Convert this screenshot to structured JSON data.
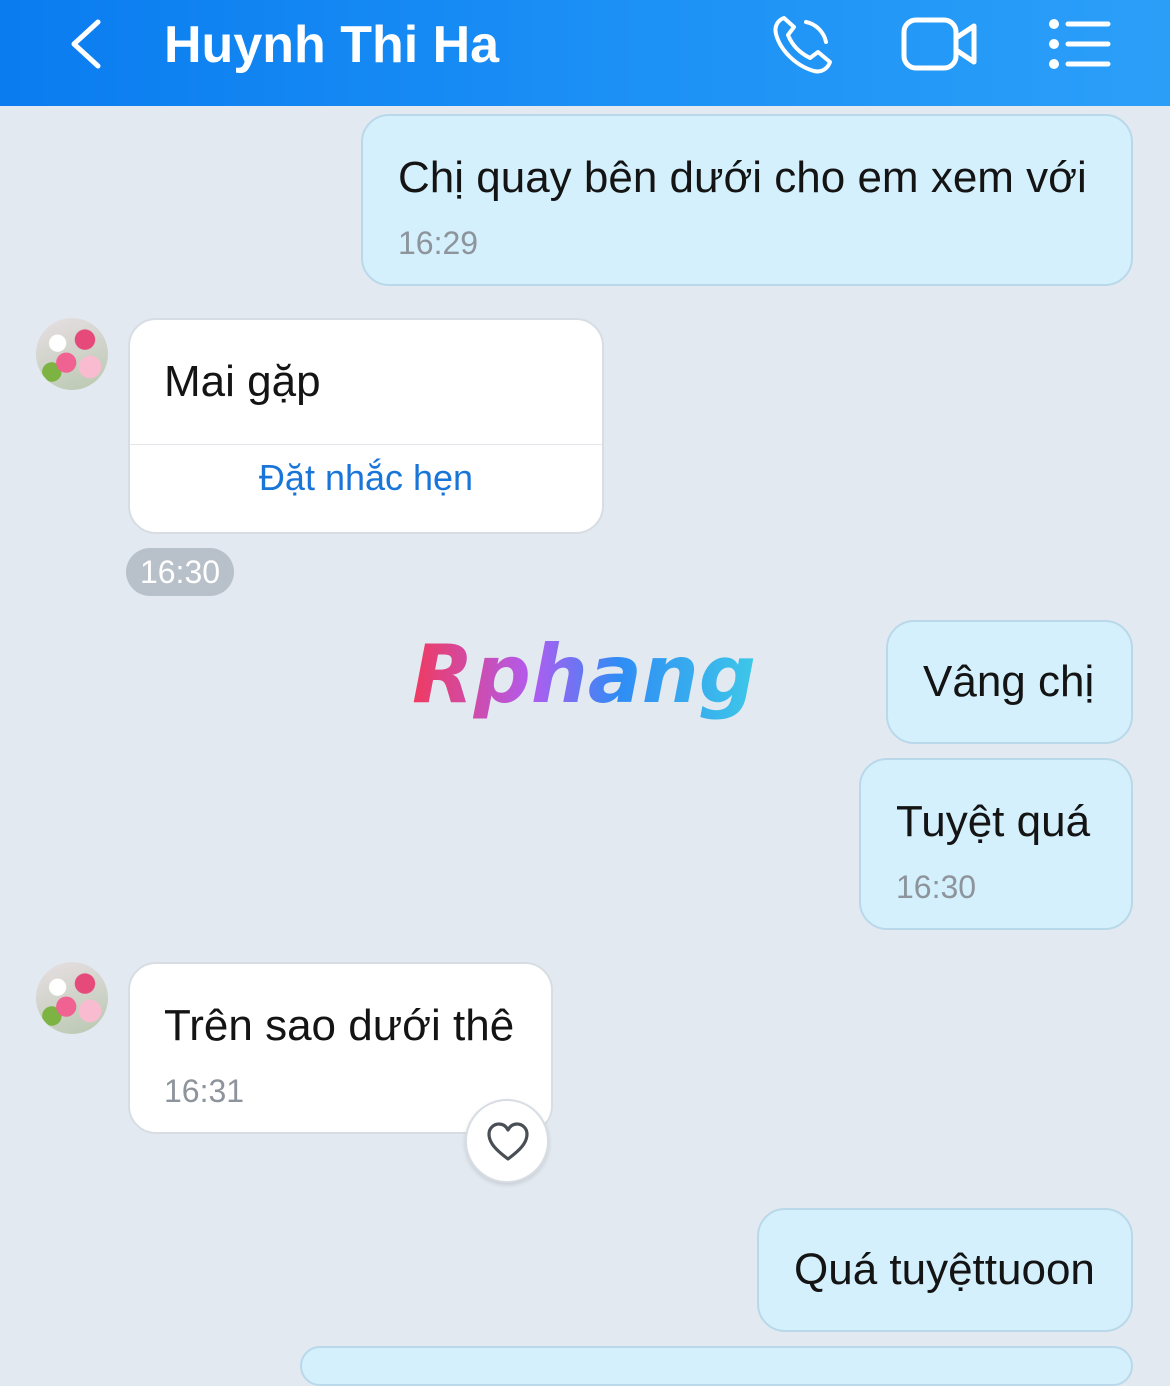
{
  "header": {
    "contact_name": "Huynh Thi Ha",
    "icons": [
      "back-icon",
      "phone-icon",
      "video-call-icon",
      "menu-icon"
    ]
  },
  "colors": {
    "header_blue": "#0a7cf0",
    "outgoing_bubble": "#d4f0fc",
    "incoming_bubble": "#ffffff",
    "chat_background": "#e2e9f1",
    "link_blue": "#1a75d8"
  },
  "watermark": {
    "text": "Rphang"
  },
  "messages": [
    {
      "direction": "out",
      "text": "Chị quay bên dưới cho em xem với",
      "time": "16:29"
    },
    {
      "direction": "in",
      "text": "Mai gặp",
      "action": "Đặt nhắc hẹn",
      "time": "16:30"
    },
    {
      "direction": "out",
      "text": "Vâng chị"
    },
    {
      "direction": "out",
      "text": "Tuyệt quá",
      "time": "16:30"
    },
    {
      "direction": "in",
      "text": "Trên sao dưới thê",
      "time": "16:31",
      "reaction_icon": "heart-icon"
    },
    {
      "direction": "out",
      "text": "Quá tuyệttuoon"
    }
  ]
}
